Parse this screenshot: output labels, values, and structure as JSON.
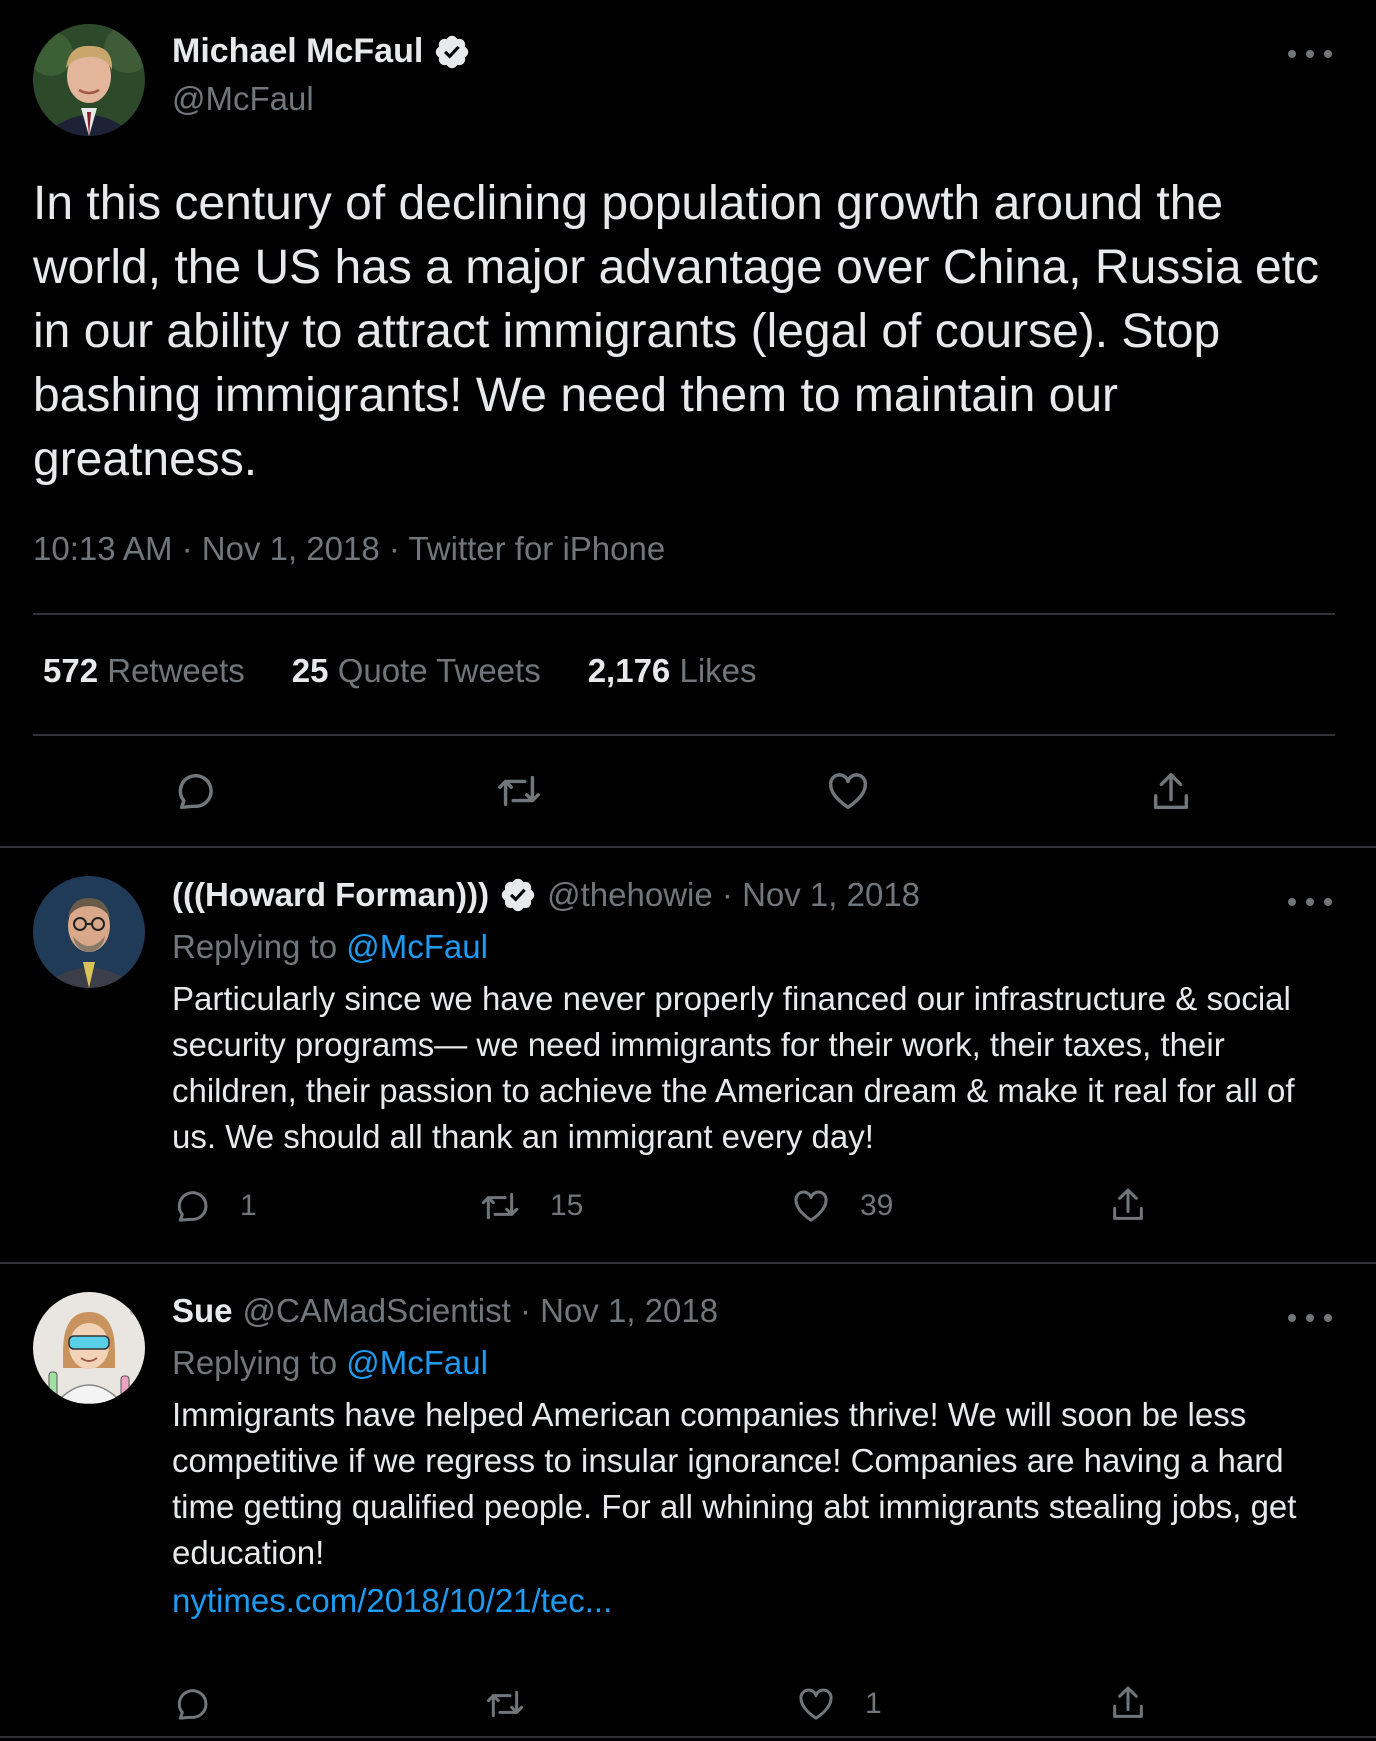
{
  "main_tweet": {
    "author_name": "Michael McFaul",
    "author_handle": "@McFaul",
    "text": "In this century of declining population growth around the world, the US has a major advantage over China, Russia etc in our ability to attract immigrants (legal of course). Stop bashing immigrants! We need them to maintain our greatness.",
    "meta": "10:13 AM · Nov 1, 2018 · Twitter for iPhone",
    "stats": {
      "retweets_count": "572",
      "retweets_label": "Retweets",
      "quotes_count": "25",
      "quotes_label": "Quote Tweets",
      "likes_count": "2,176",
      "likes_label": "Likes"
    }
  },
  "replies": [
    {
      "author_name": "(((Howard Forman)))",
      "verified": true,
      "handle_date": "@thehowie · Nov 1, 2018",
      "replying_prefix": "Replying to",
      "replying_to": "@McFaul",
      "text": "Particularly since we have never properly financed our infrastructure & social security programs— we need immigrants for their work, their taxes, their children, their passion to achieve the American dream & make it real for all of us. We should all thank an immigrant every day!",
      "link": "",
      "reply_count": "1",
      "retweet_count": "15",
      "like_count": "39"
    },
    {
      "author_name": "Sue",
      "verified": false,
      "handle_date": "@CAMadScientist · Nov 1, 2018",
      "replying_prefix": "Replying to",
      "replying_to": "@McFaul",
      "text": "Immigrants have helped American companies thrive! We will soon be less competitive if we regress to insular ignorance! Companies are having a hard time getting qualified people. For all whining abt immigrants stealing jobs, get education!",
      "link": "nytimes.com/2018/10/21/tec...",
      "reply_count": "",
      "retweet_count": "",
      "like_count": "1"
    }
  ],
  "colors": {
    "background": "#000000",
    "text_primary": "#e7e9ea",
    "text_muted": "#71767b",
    "link": "#1d9bf0",
    "divider": "#2f3336"
  },
  "icons": {
    "verified": "verified-badge-icon",
    "more": "more-horizontal-icon",
    "reply": "reply-bubble-icon",
    "retweet": "retweet-icon",
    "like": "heart-icon",
    "share": "share-upload-icon"
  }
}
